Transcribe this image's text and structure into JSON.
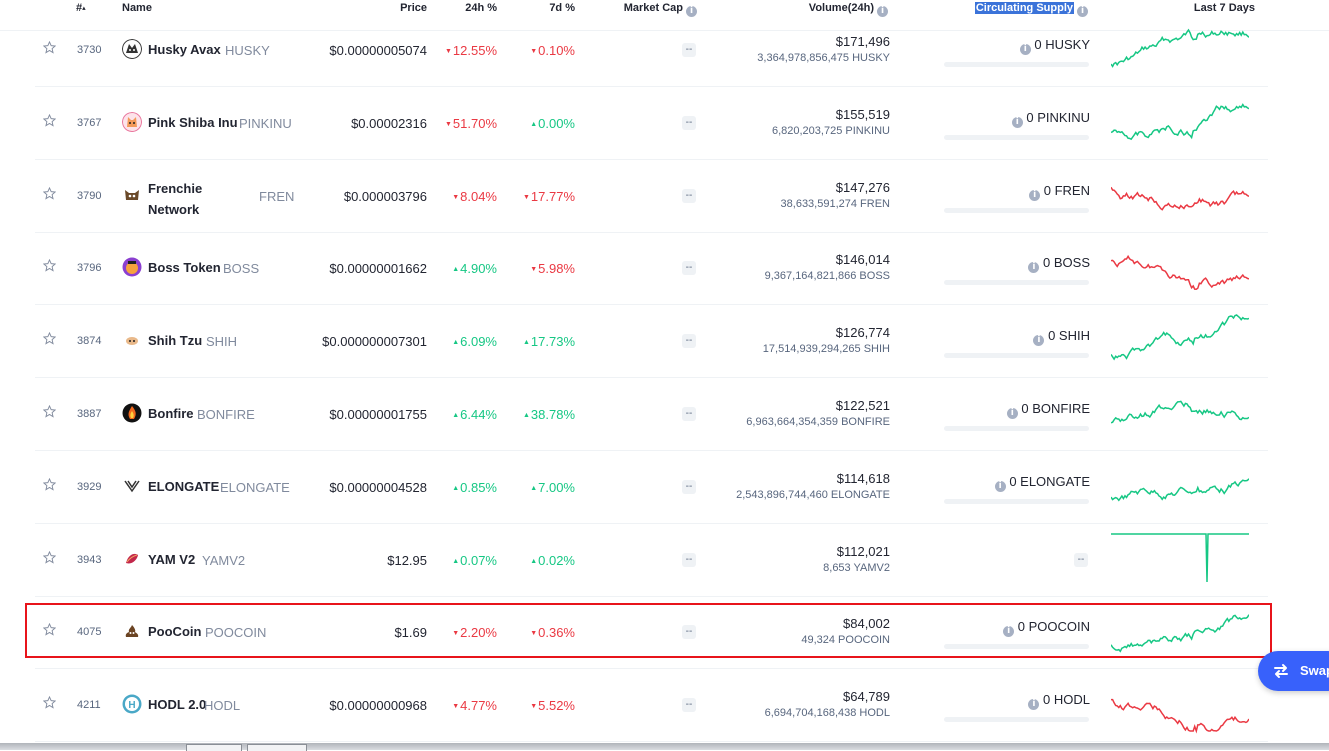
{
  "header": {
    "rank": "#",
    "rank_sort": "▴",
    "name": "Name",
    "price": "Price",
    "change24h": "24h %",
    "change7d": "7d %",
    "market_cap": "Market Cap",
    "volume": "Volume(24h)",
    "supply": "Circulating Supply",
    "last7": "Last 7 Days",
    "info_glyph": "i"
  },
  "rows": [
    {
      "rank": "3730",
      "name": "Husky Avax",
      "symbol": "HUSKY",
      "price": "$0.00000005074",
      "c24": "12.55%",
      "d24": "down",
      "c7": "0.10%",
      "d7": "down",
      "mcap": "--",
      "vol": "$171,496",
      "vol_sub": "3,364,978,856,475 HUSKY",
      "supply": "0 HUSKY",
      "trend": "up",
      "logo": "husky-logo"
    },
    {
      "rank": "3767",
      "name": "Pink Shiba Inu",
      "symbol": "PINKINU",
      "price": "$0.00002316",
      "c24": "51.70%",
      "d24": "down",
      "c7": "0.00%",
      "d7": "up",
      "mcap": "--",
      "vol": "$155,519",
      "vol_sub": "6,820,203,725 PINKINU",
      "supply": "0 PINKINU",
      "trend": "up",
      "logo": "pink-shiba-logo"
    },
    {
      "rank": "3790",
      "name": "Frenchie Network",
      "symbol": "FREN",
      "price": "$0.000003796",
      "c24": "8.04%",
      "d24": "down",
      "c7": "17.77%",
      "d7": "down",
      "mcap": "--",
      "vol": "$147,276",
      "vol_sub": "38,633,591,274 FREN",
      "supply": "0 FREN",
      "trend": "down",
      "logo": "frenchie-logo"
    },
    {
      "rank": "3796",
      "name": "Boss Token",
      "symbol": "BOSS",
      "price": "$0.00000001662",
      "c24": "4.90%",
      "d24": "up",
      "c7": "5.98%",
      "d7": "down",
      "mcap": "--",
      "vol": "$146,014",
      "vol_sub": "9,367,164,821,866 BOSS",
      "supply": "0 BOSS",
      "trend": "down",
      "logo": "boss-logo"
    },
    {
      "rank": "3874",
      "name": "Shih Tzu",
      "symbol": "SHIH",
      "price": "$0.000000007301",
      "c24": "6.09%",
      "d24": "up",
      "c7": "17.73%",
      "d7": "up",
      "mcap": "--",
      "vol": "$126,774",
      "vol_sub": "17,514,939,294,265 SHIH",
      "supply": "0 SHIH",
      "trend": "up",
      "logo": "shih-tzu-logo"
    },
    {
      "rank": "3887",
      "name": "Bonfire",
      "symbol": "BONFIRE",
      "price": "$0.00000001755",
      "c24": "6.44%",
      "d24": "up",
      "c7": "38.78%",
      "d7": "up",
      "mcap": "--",
      "vol": "$122,521",
      "vol_sub": "6,963,664,354,359 BONFIRE",
      "supply": "0 BONFIRE",
      "trend": "up",
      "logo": "bonfire-logo"
    },
    {
      "rank": "3929",
      "name": "ELONGATE",
      "symbol": "ELONGATE",
      "price": "$0.00000004528",
      "c24": "0.85%",
      "d24": "up",
      "c7": "7.00%",
      "d7": "up",
      "mcap": "--",
      "vol": "$114,618",
      "vol_sub": "2,543,896,744,460 ELONGATE",
      "supply": "0 ELONGATE",
      "trend": "up",
      "logo": "elongate-logo"
    },
    {
      "rank": "3943",
      "name": "YAM V2",
      "symbol": "YAMV2",
      "price": "$12.95",
      "c24": "0.07%",
      "d24": "up",
      "c7": "0.02%",
      "d7": "up",
      "mcap": "--",
      "vol": "$112,021",
      "vol_sub": "8,653 YAMV2",
      "supply": "--",
      "trend": "up",
      "logo": "yam-logo"
    },
    {
      "rank": "4075",
      "name": "PooCoin",
      "symbol": "POOCOIN",
      "price": "$1.69",
      "c24": "2.20%",
      "d24": "down",
      "c7": "0.36%",
      "d7": "down",
      "mcap": "--",
      "vol": "$84,002",
      "vol_sub": "49,324 POOCOIN",
      "supply": "0 POOCOIN",
      "trend": "up",
      "logo": "poocoin-logo"
    },
    {
      "rank": "4211",
      "name": "HODL 2.0",
      "symbol": "HODL",
      "price": "$0.00000000968",
      "c24": "4.77%",
      "d24": "down",
      "c7": "5.52%",
      "d7": "down",
      "mcap": "--",
      "vol": "$64,789",
      "vol_sub": "6,694,704,168,438 HODL",
      "supply": "0 HODL",
      "trend": "down",
      "logo": "hodl-logo"
    }
  ],
  "swap": {
    "label": "Swap"
  },
  "colors": {
    "up": "#16c784",
    "down": "#ea3943",
    "selection": "#e8141b",
    "swap": "#3861fb"
  }
}
